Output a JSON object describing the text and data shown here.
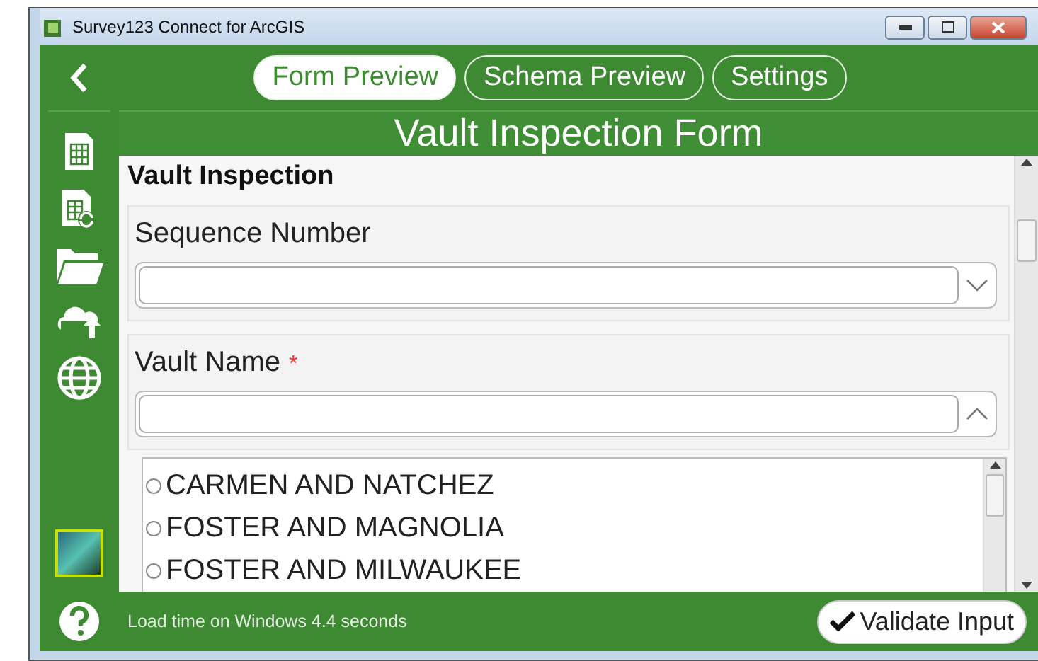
{
  "window": {
    "title": "Survey123 Connect for ArcGIS"
  },
  "tabs": [
    {
      "label": "Form Preview",
      "selected": true
    },
    {
      "label": "Schema Preview",
      "selected": false
    },
    {
      "label": "Settings",
      "selected": false
    }
  ],
  "form": {
    "title": "Vault Inspection Form",
    "group_title": "Vault Inspection",
    "questions": [
      {
        "label": "Sequence Number",
        "expanded": false
      },
      {
        "label": "Vault Name",
        "required_mark": "*",
        "expanded": true,
        "options": [
          {
            "label": "CARMEN AND NATCHEZ",
            "selected": false
          },
          {
            "label": "FOSTER AND MAGNOLIA",
            "selected": false
          },
          {
            "label": "FOSTER AND MILWAUKEE",
            "selected": false
          }
        ]
      }
    ]
  },
  "status_bar": {
    "message": "Load time on Windows 4.4 seconds",
    "button": "Validate Input"
  }
}
